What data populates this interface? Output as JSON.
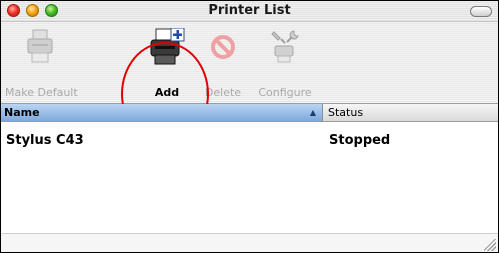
{
  "window": {
    "title": "Printer List"
  },
  "toolbar": {
    "items": [
      {
        "label": "Make Default",
        "icon": "printer-default-icon",
        "enabled": false
      },
      {
        "label": "Add",
        "icon": "printer-add-icon",
        "enabled": true
      },
      {
        "label": "Delete",
        "icon": "delete-icon",
        "enabled": false
      },
      {
        "label": "Configure",
        "icon": "configure-icon",
        "enabled": false
      }
    ]
  },
  "table": {
    "columns": [
      {
        "label": "Name"
      },
      {
        "label": "Status"
      }
    ],
    "sort_indicator": "▲",
    "rows": [
      {
        "name": "Stylus C43",
        "status": "Stopped"
      }
    ]
  },
  "colors": {
    "highlight_circle": "#e00000",
    "selected_header": "#9dbfe8"
  }
}
